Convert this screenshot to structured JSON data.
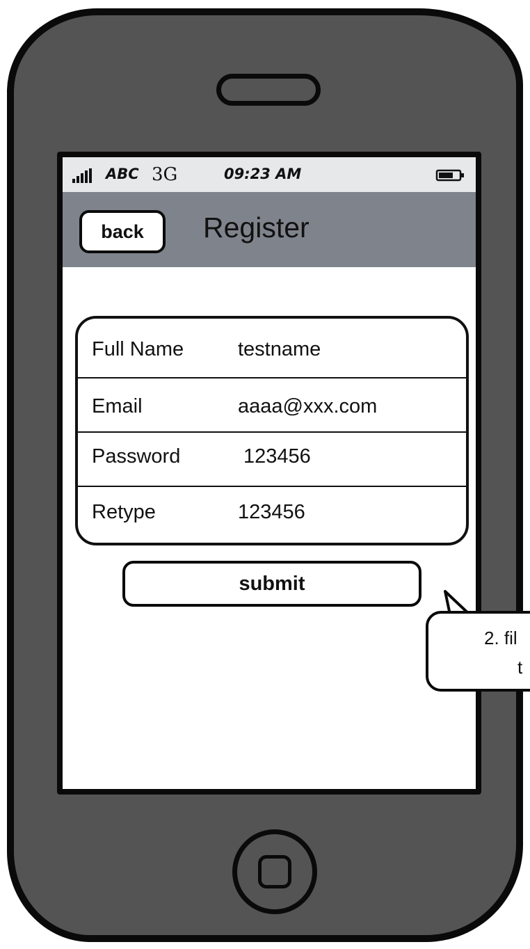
{
  "status_bar": {
    "carrier": "ABC",
    "network": "3G",
    "time": "09:23 AM"
  },
  "nav_bar": {
    "back_label": "back",
    "title": "Register"
  },
  "form": {
    "rows": [
      {
        "label": "Full Name",
        "value": "testname"
      },
      {
        "label": "Email",
        "value": "aaaa@xxx.com"
      },
      {
        "label": "Password",
        "value": "123456"
      },
      {
        "label": "Retype",
        "value": "123456"
      }
    ]
  },
  "submit_label": "submit",
  "callout": {
    "line1": "2. fil",
    "line2": "t"
  },
  "colors": {
    "phone_body": "#545454",
    "nav_bar": "#7f848c",
    "status_bar": "#e6e8ea",
    "screen": "#ffffff"
  }
}
